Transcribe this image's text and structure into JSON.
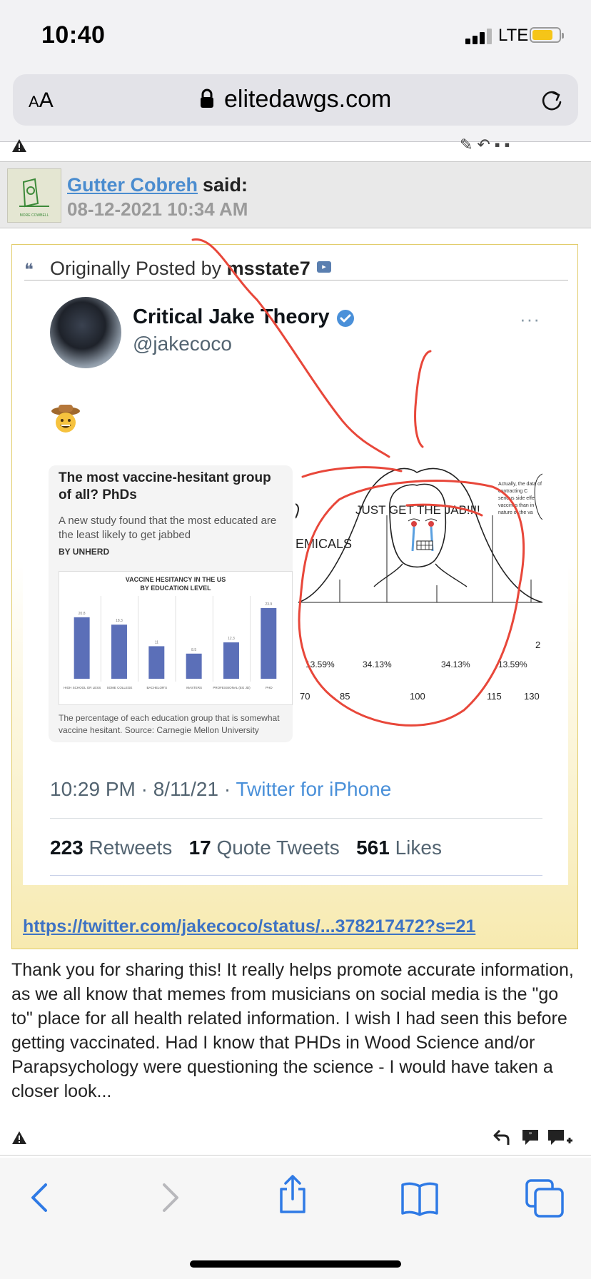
{
  "status_bar": {
    "time": "10:40",
    "network": "LTE"
  },
  "browser": {
    "text_size_label": "AA",
    "url": "elitedawgs.com"
  },
  "post": {
    "author": "Gutter Cobreh",
    "said": "said:",
    "date": "08-12-2021 10:34 AM",
    "avatar_label": "MORE COWBELL",
    "quote": {
      "prefix": "Originally Posted by",
      "author": "msstate7",
      "link": "https://twitter.com/jakecoco/status/...378217472?s=21"
    },
    "body": "Thank you for sharing this! It really helps promote accurate information, as we all know that memes from musicians on social media is the \"go to\" place for all health related information. I wish I had seen this before getting vaccinated. Had I know that PHDs in Wood Science and/or Parapsychology were questioning the science - I would have taken a closer look..."
  },
  "tweet": {
    "name": "Critical Jake Theory",
    "handle": "@jakecoco",
    "emoji": "cowboy-face",
    "time": "10:29 PM · 8/11/21 · ",
    "source": "Twitter for iPhone",
    "retweets_count": "223",
    "retweets_label": "Retweets",
    "quotes_count": "17",
    "quotes_label": "Quote Tweets",
    "likes_count": "561",
    "likes_label": "Likes",
    "more": "···"
  },
  "infographic": {
    "title": "The most vaccine-hesitant group of all? PhDs",
    "subtitle": "A new study found that the most educated are the least likely to get jabbed",
    "byline": "BY UNHERD",
    "caption": "The percentage of each education group that is somewhat vaccine hesitant. Source: Carnegie Mellon University"
  },
  "chart_data": {
    "type": "bar",
    "title": "VACCINE HESITANCY IN THE US BY EDUCATION LEVEL",
    "categories": [
      "HIGH SCHOOL OR LESS",
      "SOME COLLEGE",
      "BACHELOR'S",
      "MASTERS",
      "PROFESSIONAL (EG JD)",
      "PHD"
    ],
    "values": [
      20.8,
      18.3,
      11,
      8.5,
      12.3,
      23.9
    ],
    "ylim": [
      0,
      28
    ],
    "grid": "vertical",
    "color": "#5b6fb8"
  },
  "meme": {
    "jab_text": "JUST GET THE JAB!!!!",
    "chemicals_text": "EMICALS",
    "tiny_text": "Actually, the data of contracting C serious side effe vaccines than in nature of the va",
    "percentages": [
      "13.59%",
      "34.13%",
      "34.13%",
      "13.59%"
    ],
    "axis_labels": [
      "70",
      "85",
      "100",
      "115",
      "130"
    ],
    "right_edge_label": "2"
  },
  "colors": {
    "link": "#4a8ccf",
    "quote_bg": "#f7eab0",
    "annotation": "#e8473a",
    "twitter_blue": "#4a90d9"
  },
  "toolbar_icons": [
    "back-icon",
    "forward-icon",
    "share-icon",
    "bookmarks-icon",
    "tabs-icon"
  ]
}
